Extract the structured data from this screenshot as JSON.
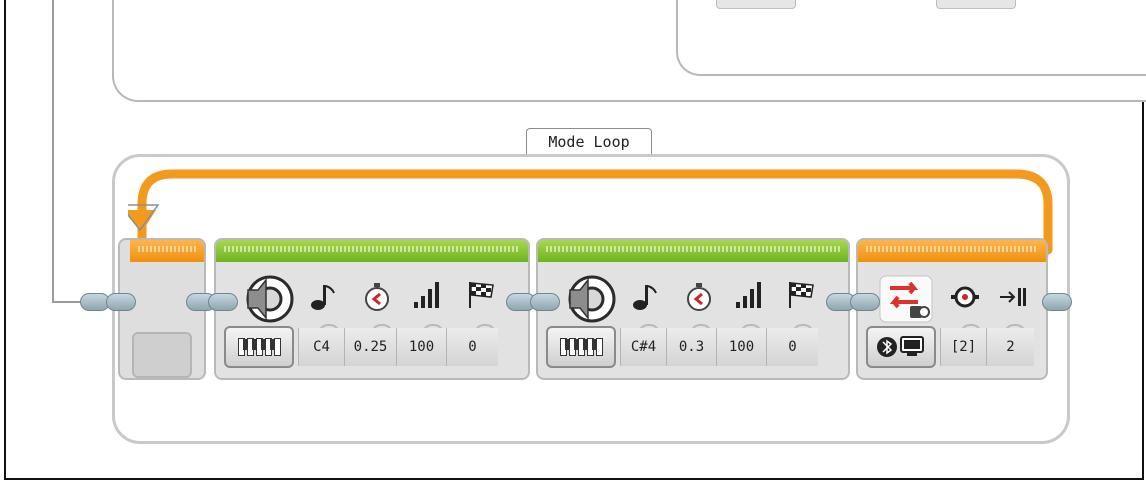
{
  "loop": {
    "label": "Mode Loop"
  },
  "colors": {
    "loop_wire": "#f39a1e",
    "sound_header": "#8cc63f",
    "action_header": "#f7a21b",
    "connector": "#8fa9b3"
  },
  "sound_blocks": [
    {
      "mode_icon": "piano-keys-icon",
      "note": "C4",
      "duration": "0.25",
      "volume": "100",
      "play_type": "0"
    },
    {
      "mode_icon": "piano-keys-icon",
      "note": "C#4",
      "duration": "0.3",
      "volume": "100",
      "play_type": "0"
    }
  ],
  "messaging_block": {
    "mode_icon": "bluetooth-computer-icon",
    "message": "[2]",
    "length": "2"
  },
  "icons": {
    "speaker": "speaker-icon",
    "note": "music-note-icon",
    "duration": "stopwatch-icon",
    "volume": "volume-bars-icon",
    "play_type": "checkered-flag-icon",
    "switch": "red-arrows-switch-icon",
    "channel": "connection-icon",
    "length": "width-arrow-icon"
  }
}
